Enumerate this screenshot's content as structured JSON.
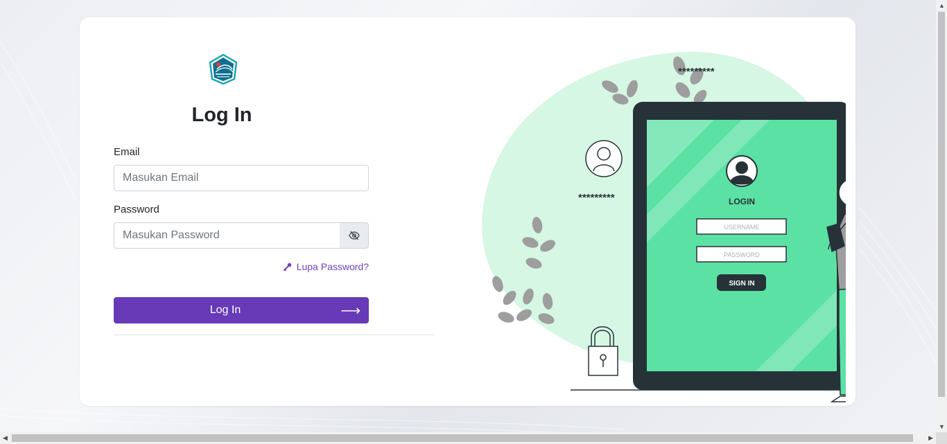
{
  "login": {
    "title": "Log In",
    "email_label": "Email",
    "email_placeholder": "Masukan Email",
    "password_label": "Password",
    "password_placeholder": "Masukan Password",
    "forgot_label": "Lupa Password?",
    "submit_label": "Log In",
    "submit_arrow": "⟶"
  },
  "illustration": {
    "login_heading": "LOGIN",
    "username_placeholder": "USERNAME",
    "password_placeholder": "PASSWORD",
    "signin_label": "SIGN IN",
    "masked_1": "*********",
    "masked_2": "*********",
    "masked_3": "*********"
  },
  "colors": {
    "accent": "#673ab7",
    "link": "#6f42c1",
    "screen_green": "#5ce1a4",
    "blob_green": "#d5f7e4",
    "device_dark": "#263238"
  },
  "icons": {
    "logo": "institution-seal",
    "eye": "eye-slash-icon",
    "key": "key-icon"
  }
}
